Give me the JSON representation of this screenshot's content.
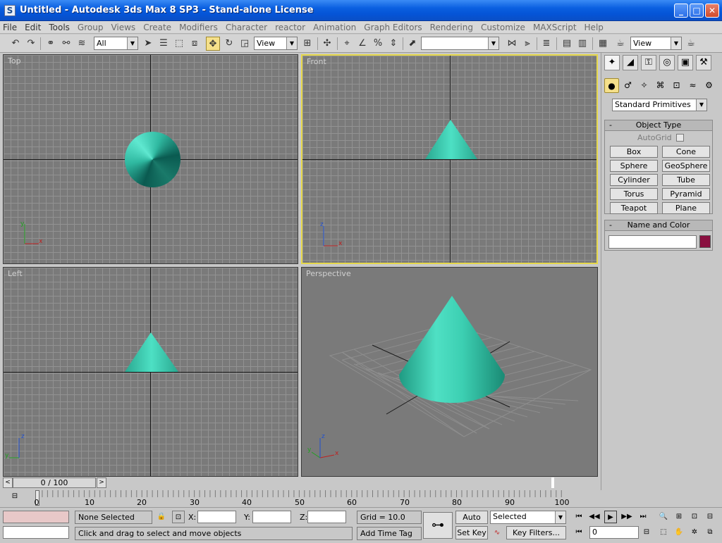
{
  "window": {
    "title": "Untitled  - Autodesk 3ds Max 8 SP3  - Stand-alone License",
    "app_icon": "S",
    "minimize": "_",
    "maximize": "□",
    "close": "✕"
  },
  "menu": [
    "File",
    "Edit",
    "Tools",
    "Group",
    "Views",
    "Create",
    "Modifiers",
    "Character",
    "reactor",
    "Animation",
    "Graph Editors",
    "Rendering",
    "Customize",
    "MAXScript",
    "Help"
  ],
  "toolbar": {
    "selection_filter": "All",
    "ref_coord": "View",
    "named_selection": "",
    "render_view": "View"
  },
  "viewports": {
    "top": "Top",
    "front": "Front",
    "left": "Left",
    "perspective": "Perspective",
    "axis_x": "x",
    "axis_y": "y",
    "axis_z": "z"
  },
  "command_panel": {
    "category": "Standard Primitives",
    "object_type_title": "Object Type",
    "autogrid": "AutoGrid",
    "rollout_toggle": "-",
    "buttons": [
      "Box",
      "Cone",
      "Sphere",
      "GeoSphere",
      "Cylinder",
      "Tube",
      "Torus",
      "Pyramid",
      "Teapot",
      "Plane"
    ],
    "name_color_title": "Name and Color",
    "object_color": "#8a1040"
  },
  "timeline": {
    "slider_label": "0 / 100",
    "ticks": [
      "0",
      "10",
      "20",
      "30",
      "40",
      "50",
      "60",
      "70",
      "80",
      "90",
      "100"
    ]
  },
  "status": {
    "selection": "None Selected",
    "prompt": "Click and drag to select and move objects",
    "x_label": "X:",
    "y_label": "Y:",
    "z_label": "Z:",
    "grid": "Grid = 10.0",
    "add_time_tag": "Add Time Tag",
    "auto_key": "Auto Key",
    "set_key": "Set Key",
    "key_mode": "Selected",
    "key_filters": "Key Filters...",
    "frame": "0"
  }
}
